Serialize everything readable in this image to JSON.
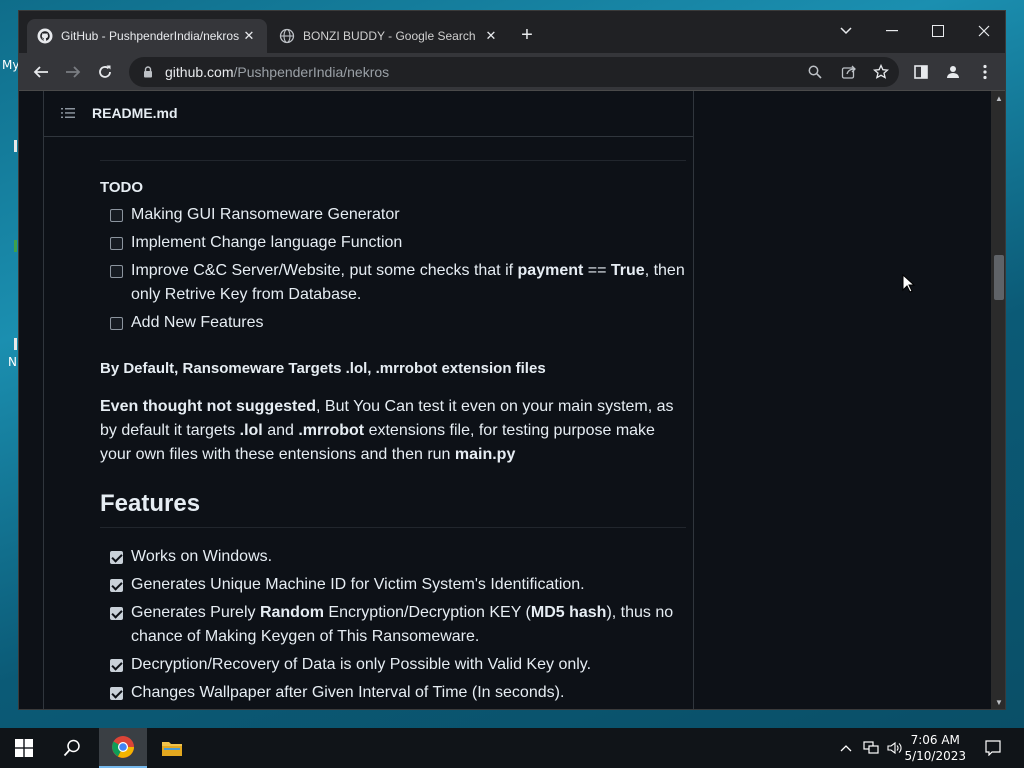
{
  "desktop": {
    "label_my": "My",
    "label_n": "N"
  },
  "tabs": [
    {
      "title": "GitHub - PushpenderIndia/nekros",
      "active": true
    },
    {
      "title": "BONZI BUDDY - Google Search",
      "active": false
    }
  ],
  "address": {
    "host": "github.com",
    "path": "/PushpenderIndia/nekros"
  },
  "readme": {
    "filename": "README.md",
    "todo_title": "TODO",
    "todo_items": [
      {
        "text": "Making GUI Ransomeware Generator",
        "checked": false
      },
      {
        "text": "Implement Change language Function",
        "checked": false
      },
      {
        "pre": "Improve C&C Server/Website, put some checks that if ",
        "b1": "payment",
        "mid": " == ",
        "b2": "True",
        "post": ", then only Retrive Key from Database.",
        "checked": false
      },
      {
        "text": "Add New Features",
        "checked": false
      }
    ],
    "default_note": "By Default, Ransomeware Targets .lol, .mrrobot extension files",
    "para": {
      "b1": "Even thought not suggested",
      "t1": ", But You Can test it even on your main system, as by default it targets ",
      "b2": ".lol",
      "t2": " and ",
      "b3": ".mrrobot",
      "t3": " extensions file, for testing purpose make your own files with these entensions and then run ",
      "b4": "main.py"
    },
    "features_title": "Features",
    "features": [
      {
        "text": "Works on Windows.",
        "checked": true
      },
      {
        "text": "Generates Unique Machine ID for Victim System's Identification.",
        "checked": true
      },
      {
        "pre": "Generates Purely ",
        "b1": "Random",
        "mid": " Encryption/Decryption KEY (",
        "b2": "MD5 hash",
        "post": "), thus no chance of Making Keygen of This Ransomeware.",
        "checked": true
      },
      {
        "text": "Decryption/Recovery of Data is only Possible with Valid Key only.",
        "checked": true
      },
      {
        "text": "Changes Wallpaper after Given Interval of Time (In seconds).",
        "checked": true
      }
    ]
  },
  "clock": {
    "time": "7:06 AM",
    "date": "5/10/2023"
  },
  "colors": {
    "page_bg": "#0d1117",
    "chrome_dark": "#202124",
    "chrome_toolbar": "#35363a",
    "text": "#e6edf3"
  }
}
